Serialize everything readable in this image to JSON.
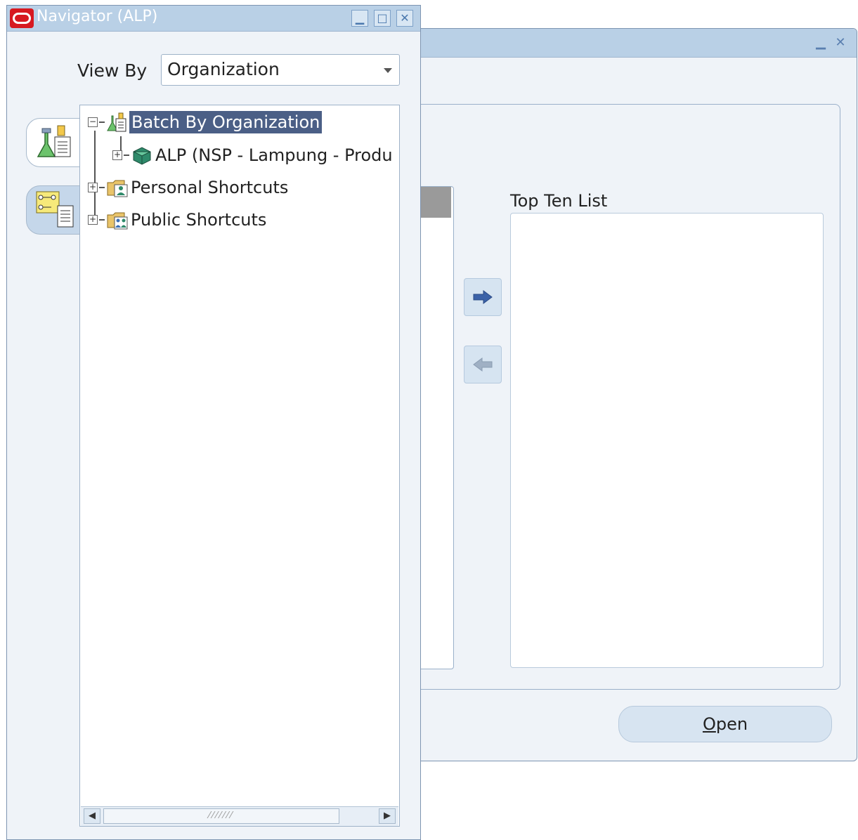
{
  "navigator": {
    "title": "Navigator (ALP)",
    "view_by_label": "View By",
    "view_by_value": "Organization",
    "tree": [
      {
        "label": "Batch By Organization",
        "expanded": true,
        "selected": true,
        "icon": "process-icon"
      },
      {
        "label": "ALP (NSP - Lampung - Produ",
        "expanded": false,
        "selected": false,
        "icon": "organization-icon"
      },
      {
        "label": "Personal Shortcuts",
        "expanded": false,
        "selected": false,
        "icon": "folder-person-icon"
      },
      {
        "label": "Public Shortcuts",
        "expanded": false,
        "selected": false,
        "icon": "folder-group-icon"
      }
    ],
    "tabs": [
      {
        "icon": "process-execution-icon"
      },
      {
        "icon": "document-workflow-icon"
      }
    ]
  },
  "main": {
    "top_ten_label": "Top Ten List",
    "open_label_prefix": "",
    "open_label_mnemonic": "O",
    "open_label_rest": "pen"
  },
  "colors": {
    "title_bar": "#b9d0e6",
    "window_bg": "#eff3f8",
    "selection": "#4b5f86",
    "oracle_red": "#d71920"
  }
}
